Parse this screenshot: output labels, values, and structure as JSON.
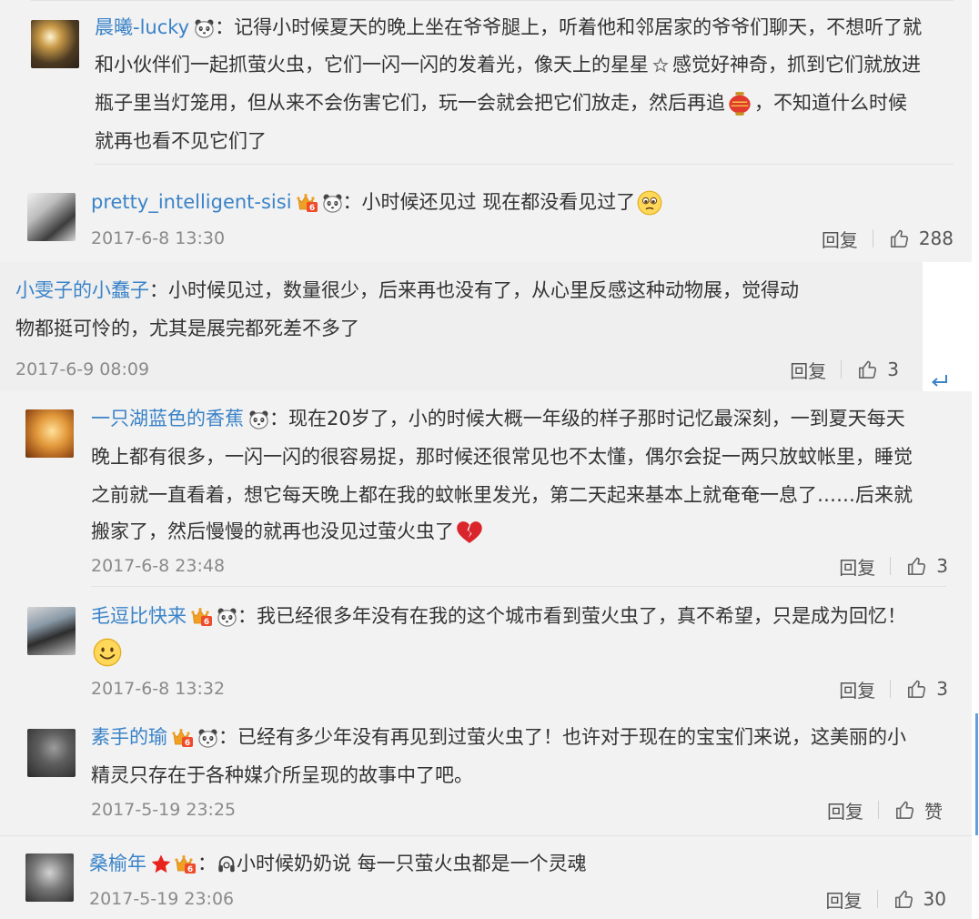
{
  "comments": [
    {
      "user": "晨曦-lucky",
      "lines": [
        "：记得小时候夏天的晚上坐在爷爷腿上，听着他和邻居家的爷爷们聊天，不想听了就",
        "和小伙伴们一起抓萤火虫，它们一闪一闪的发着光，像天上的星星",
        "感觉好神奇，抓到它们就放进",
        "瓶子里当灯笼用，但从来不会伤害它们，玩一会就会把它们放走，然后再追",
        "，不知道什么时候",
        "就再也看不见它们了"
      ]
    },
    {
      "user": "pretty_intelligent-sisi",
      "text": "：小时候还见过 现在都没看见过了",
      "time": "2017-6-8 13:30",
      "reply": "回复",
      "likes": "288"
    },
    {
      "user": "小雯子的小蠢子",
      "line1": "：小时候见过，数量很少，后来再也没有了，从心里反感这种动物展，觉得动",
      "line2": "物都挺可怜的，尤其是展完都死差不多了",
      "time": "2017-6-9 08:09",
      "reply": "回复",
      "likes": "3"
    },
    {
      "user": "一只湖蓝色的香蕉",
      "line1": "：现在20岁了，小的时候大概一年级的样子那时记忆最深刻，一到夏天每天",
      "line2": "晚上都有很多，一闪一闪的很容易捉，那时候还很常见也不太懂，偶尔会捉一两只放蚊帐里，睡觉",
      "line3": "之前就一直看着，想它每天晚上都在我的蚊帐里发光，第二天起来基本上就奄奄一息了……后来就",
      "line4": "搬家了，然后慢慢的就再也没见过萤火虫了",
      "time": "2017-6-8 23:48",
      "reply": "回复",
      "likes": "3"
    },
    {
      "user": "毛逗比快来",
      "text": "：我已经很多年没有在我的这个城市看到萤火虫了，真不希望，只是成为回忆！",
      "time": "2017-6-8 13:32",
      "reply": "回复",
      "likes": "3"
    },
    {
      "user": "素手的瑜",
      "line1": "：已经有多少年没有再见到过萤火虫了！也许对于现在的宝宝们来说，这美丽的小",
      "line2": "精灵只存在于各种媒介所呈现的故事中了吧。",
      "time": "2017-5-19 23:25",
      "reply": "回复",
      "likes": "赞"
    },
    {
      "user": "桑榆年",
      "text": "小时候奶奶说 每一只萤火虫都是一个灵魂",
      "sep": "：",
      "time": "2017-5-19 23:06",
      "reply": "回复",
      "likes": "30"
    }
  ],
  "colors": {
    "username": "#3a83c8",
    "timestamp": "#8a8a8a",
    "highlight_bg": "#efefef",
    "panel_bg": "#f2f2f2"
  }
}
